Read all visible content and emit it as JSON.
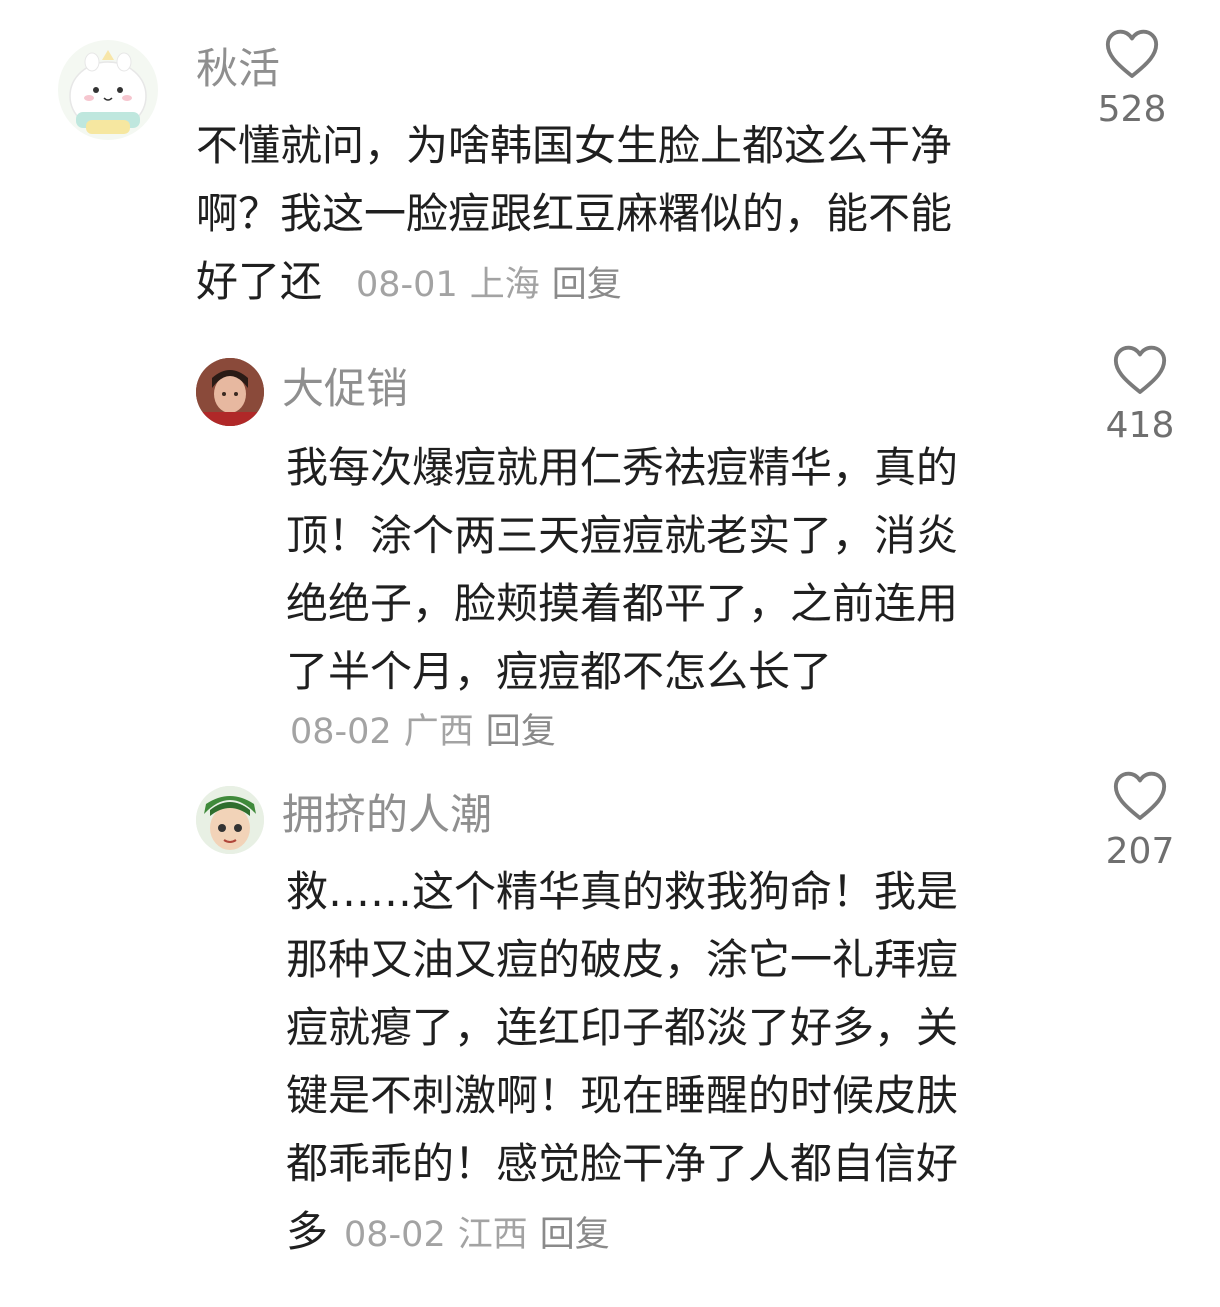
{
  "comments": [
    {
      "author": "秋活",
      "avatar_icon": "bunny-cartoon-avatar",
      "lines": [
        "不懂就问，为啥韩国女生脸上都这么干净",
        "啊？我这一脸痘跟红豆麻糬似的，能不能",
        "好了还"
      ],
      "date": "08-01",
      "location": "上海",
      "reply_label": "回复",
      "likes": "528"
    },
    {
      "author": "大促销",
      "avatar_icon": "person-photo-avatar",
      "lines": [
        "我每次爆痘就用仁秀祛痘精华，真的",
        "顶！涂个两三天痘痘就老实了，消炎",
        "绝绝子，脸颊摸着都平了，之前连用",
        "了半个月，痘痘都不怎么长了"
      ],
      "date": "08-02",
      "location": "广西",
      "reply_label": "回复",
      "likes": "418"
    },
    {
      "author": "拥挤的人潮",
      "avatar_icon": "anime-character-avatar",
      "lines": [
        "救……这个精华真的救我狗命！我是",
        "那种又油又痘的破皮，涂它一礼拜痘",
        "痘就瘪了，连红印子都淡了好多，关",
        "键是不刺激啊！现在睡醒的时候皮肤",
        "都乖乖的！感觉脸干净了人都自信好",
        "多"
      ],
      "date": "08-02",
      "location": "江西",
      "reply_label": "回复",
      "likes": "207"
    }
  ]
}
